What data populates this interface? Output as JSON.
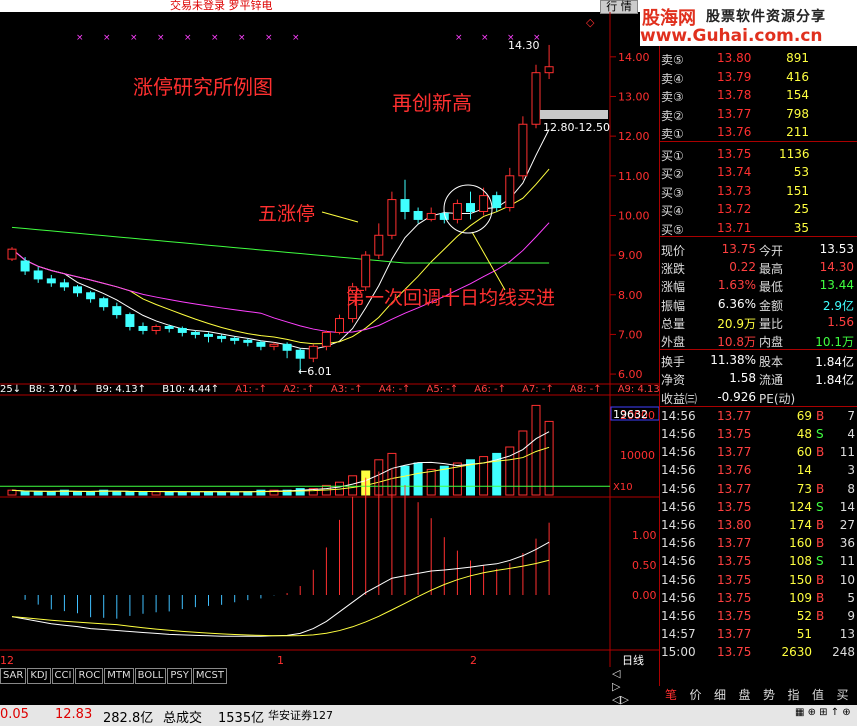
{
  "topbar": {
    "status": "交易未登录   罗平锌电",
    "button": "行 情"
  },
  "logo": {
    "brand": "股海网",
    "slogan": "股票软件资源分享",
    "url": "www.Guhai.com.cn"
  },
  "chart": {
    "annotation_title": "涨停研究所例图",
    "annotation_high": "再创新高",
    "annotation_limit": "五涨停",
    "annotation_pullback": "第一次回调十日均线买进",
    "high_label": "14.30",
    "low_label": "←6.01",
    "range_label": "12.80-12.50",
    "price_ticks": [
      "14.00",
      "13.00",
      "12.00",
      "11.00",
      "10.00",
      "9.00",
      "8.00",
      "7.00",
      "6.00"
    ],
    "ma_legend": [
      {
        "text": "25↓",
        "color": "#ffffff"
      },
      {
        "text": "B8: 3.70↓",
        "color": "#ffffff"
      },
      {
        "text": "B9: 4.13↑",
        "color": "#ffffff"
      },
      {
        "text": "B10: 4.44↑",
        "color": "#ffffff"
      },
      {
        "text": "A1: -↑",
        "color": "#ff4040"
      },
      {
        "text": "A2: -↑",
        "color": "#ff4040"
      },
      {
        "text": "A3: -↑",
        "color": "#ff4040"
      },
      {
        "text": "A4: -↑",
        "color": "#ff4040"
      },
      {
        "text": "A5: -↑",
        "color": "#ff4040"
      },
      {
        "text": "A6: -↑",
        "color": "#ff4040"
      },
      {
        "text": "A7: -↑",
        "color": "#ff4040"
      },
      {
        "text": "A8: -↑",
        "color": "#ff4040"
      },
      {
        "text": "A9: 4.13↑",
        "color": "#ff4040"
      },
      {
        "text": "A10: 4.44↑",
        "color": "#ff4040"
      }
    ],
    "vol_value": "19632",
    "vol_ticks": [
      "20000",
      "10000"
    ],
    "vol_unit": "X10",
    "macd_ticks": [
      "1.00",
      "0.50",
      "0.00"
    ],
    "date_labels": [
      "12",
      "1",
      "2"
    ],
    "period": "日线"
  },
  "indicator_tabs": [
    "SAR",
    "KDJ",
    "CCI",
    "ROC",
    "MTM",
    "BOLL",
    "PSY",
    "MCST"
  ],
  "order_book": {
    "sell": [
      {
        "label": "卖⑤",
        "price": "13.80",
        "vol": "891"
      },
      {
        "label": "卖④",
        "price": "13.79",
        "vol": "416"
      },
      {
        "label": "卖③",
        "price": "13.78",
        "vol": "154"
      },
      {
        "label": "卖②",
        "price": "13.77",
        "vol": "798"
      },
      {
        "label": "卖①",
        "price": "13.76",
        "vol": "211"
      }
    ],
    "buy": [
      {
        "label": "买①",
        "price": "13.75",
        "vol": "1136"
      },
      {
        "label": "买②",
        "price": "13.74",
        "vol": "53"
      },
      {
        "label": "买③",
        "price": "13.73",
        "vol": "151"
      },
      {
        "label": "买④",
        "price": "13.72",
        "vol": "25"
      },
      {
        "label": "买⑤",
        "price": "13.71",
        "vol": "35"
      }
    ]
  },
  "stats": [
    {
      "l1": "现价",
      "v1": "13.75",
      "c1": "#ff4040",
      "l2": "今开",
      "v2": "13.53",
      "c2": "#ffffff"
    },
    {
      "l1": "涨跌",
      "v1": "0.22",
      "c1": "#ff4040",
      "l2": "最高",
      "v2": "14.30",
      "c2": "#ff4040"
    },
    {
      "l1": "涨幅",
      "v1": "1.63%",
      "c1": "#ff4040",
      "l2": "最低",
      "v2": "13.44",
      "c2": "#40ff40"
    },
    {
      "l1": "振幅",
      "v1": "6.36%",
      "c1": "#ffffff",
      "l2": "金额",
      "v2": "2.9亿",
      "c2": "#40ffff"
    },
    {
      "l1": "总量",
      "v1": "20.9万",
      "c1": "#ffff40",
      "l2": "量比",
      "v2": "1.56",
      "c2": "#ff4040"
    },
    {
      "l1": "外盘",
      "v1": "10.8万",
      "c1": "#ff4040",
      "l2": "内盘",
      "v2": "10.1万",
      "c2": "#40ff40"
    },
    {
      "l1": "换手",
      "v1": "11.38%",
      "c1": "#ffffff",
      "l2": "股本",
      "v2": "1.84亿",
      "c2": "#ffffff"
    },
    {
      "l1": "净资",
      "v1": "1.58",
      "c1": "#ffffff",
      "l2": "流通",
      "v2": "1.84亿",
      "c2": "#ffffff"
    },
    {
      "l1": "收益㈢",
      "v1": "-0.926",
      "c1": "#ffffff",
      "l2": "PE(动)",
      "v2": "",
      "c2": "#ffffff"
    }
  ],
  "ticks": [
    {
      "t": "14:56",
      "p": "13.77",
      "pc": "#ff4040",
      "v": "69",
      "f": "B",
      "fc": "#ff4040",
      "n": "7"
    },
    {
      "t": "14:56",
      "p": "13.75",
      "pc": "#ff4040",
      "v": "48",
      "f": "S",
      "fc": "#40ff40",
      "n": "4"
    },
    {
      "t": "14:56",
      "p": "13.77",
      "pc": "#ff4040",
      "v": "60",
      "f": "B",
      "fc": "#ff4040",
      "n": "11"
    },
    {
      "t": "14:56",
      "p": "13.76",
      "pc": "#ff4040",
      "v": "14",
      "f": "",
      "fc": "#ffffff",
      "n": "3"
    },
    {
      "t": "14:56",
      "p": "13.77",
      "pc": "#ff4040",
      "v": "73",
      "f": "B",
      "fc": "#ff4040",
      "n": "8"
    },
    {
      "t": "14:56",
      "p": "13.75",
      "pc": "#ff4040",
      "v": "124",
      "f": "S",
      "fc": "#40ff40",
      "n": "14"
    },
    {
      "t": "14:56",
      "p": "13.80",
      "pc": "#ff4040",
      "v": "174",
      "f": "B",
      "fc": "#ff4040",
      "n": "27"
    },
    {
      "t": "14:56",
      "p": "13.77",
      "pc": "#ff4040",
      "v": "160",
      "f": "B",
      "fc": "#ff4040",
      "n": "36"
    },
    {
      "t": "14:56",
      "p": "13.75",
      "pc": "#ff4040",
      "v": "108",
      "f": "S",
      "fc": "#40ff40",
      "n": "11"
    },
    {
      "t": "14:56",
      "p": "13.75",
      "pc": "#ff4040",
      "v": "150",
      "f": "B",
      "fc": "#ff4040",
      "n": "10"
    },
    {
      "t": "14:56",
      "p": "13.75",
      "pc": "#ff4040",
      "v": "109",
      "f": "B",
      "fc": "#ff4040",
      "n": "5"
    },
    {
      "t": "14:56",
      "p": "13.75",
      "pc": "#ff4040",
      "v": "52",
      "f": "B",
      "fc": "#ff4040",
      "n": "9"
    },
    {
      "t": "14:57",
      "p": "13.77",
      "pc": "#ff4040",
      "v": "51",
      "f": "",
      "fc": "#ffffff",
      "n": "13"
    },
    {
      "t": "15:00",
      "p": "13.75",
      "pc": "#ff4040",
      "v": "2630",
      "f": "",
      "fc": "#ff40ff",
      "n": "248"
    }
  ],
  "quote_tabs": [
    "笔",
    "价",
    "细",
    "盘",
    "势",
    "指",
    "值",
    "买"
  ],
  "status_bar": {
    "v1": "0.05",
    "v2": "12.83",
    "v3": "282.8亿",
    "l4": "总成交",
    "v4": "1535亿",
    "broker": "华安证券127"
  },
  "chart_data": {
    "type": "candlestick",
    "price_range": [
      5.8,
      14.5
    ],
    "candles": [
      [
        8.9,
        9.15,
        8.85,
        9.2,
        "up"
      ],
      [
        8.85,
        8.6,
        8.5,
        8.95,
        "down"
      ],
      [
        8.6,
        8.4,
        8.3,
        8.7,
        "down"
      ],
      [
        8.4,
        8.3,
        8.2,
        8.5,
        "down"
      ],
      [
        8.3,
        8.2,
        8.1,
        8.4,
        "down"
      ],
      [
        8.2,
        8.05,
        7.95,
        8.25,
        "down"
      ],
      [
        8.05,
        7.9,
        7.8,
        8.1,
        "down"
      ],
      [
        7.9,
        7.7,
        7.6,
        7.95,
        "down"
      ],
      [
        7.7,
        7.5,
        7.4,
        7.8,
        "down"
      ],
      [
        7.5,
        7.2,
        7.1,
        7.55,
        "down"
      ],
      [
        7.2,
        7.1,
        7.0,
        7.3,
        "down"
      ],
      [
        7.1,
        7.2,
        7.0,
        7.25,
        "up"
      ],
      [
        7.2,
        7.15,
        7.05,
        7.25,
        "down"
      ],
      [
        7.15,
        7.05,
        6.95,
        7.2,
        "down"
      ],
      [
        7.05,
        7.0,
        6.9,
        7.1,
        "down"
      ],
      [
        7.0,
        6.95,
        6.8,
        7.05,
        "down"
      ],
      [
        6.95,
        6.9,
        6.8,
        7.0,
        "down"
      ],
      [
        6.9,
        6.85,
        6.75,
        6.95,
        "down"
      ],
      [
        6.85,
        6.8,
        6.7,
        6.9,
        "down"
      ],
      [
        6.8,
        6.7,
        6.6,
        6.85,
        "down"
      ],
      [
        6.7,
        6.75,
        6.6,
        6.8,
        "up"
      ],
      [
        6.75,
        6.6,
        6.4,
        6.8,
        "down"
      ],
      [
        6.6,
        6.4,
        6.01,
        6.65,
        "down"
      ],
      [
        6.4,
        6.7,
        6.3,
        6.75,
        "up"
      ],
      [
        6.7,
        7.05,
        6.6,
        7.1,
        "up"
      ],
      [
        7.05,
        7.4,
        7.0,
        7.5,
        "up"
      ],
      [
        7.4,
        8.2,
        7.3,
        8.3,
        "up"
      ],
      [
        8.2,
        9.0,
        8.1,
        9.1,
        "up"
      ],
      [
        9.0,
        9.5,
        8.9,
        9.8,
        "up"
      ],
      [
        9.5,
        10.4,
        9.4,
        10.6,
        "up"
      ],
      [
        10.4,
        10.1,
        9.9,
        10.9,
        "down"
      ],
      [
        10.1,
        9.9,
        9.8,
        10.2,
        "down"
      ],
      [
        9.9,
        10.05,
        9.85,
        10.2,
        "up"
      ],
      [
        10.05,
        9.9,
        9.8,
        10.1,
        "down"
      ],
      [
        9.9,
        10.3,
        9.8,
        10.4,
        "up"
      ],
      [
        10.3,
        10.1,
        9.9,
        10.6,
        "down"
      ],
      [
        10.1,
        10.5,
        10.0,
        10.7,
        "up"
      ],
      [
        10.5,
        10.2,
        10.1,
        10.6,
        "down"
      ],
      [
        10.2,
        11.0,
        10.1,
        11.2,
        "up"
      ],
      [
        11.0,
        12.3,
        10.9,
        12.5,
        "up"
      ],
      [
        12.3,
        13.6,
        12.2,
        13.8,
        "up"
      ],
      [
        13.6,
        13.75,
        13.44,
        14.3,
        "up"
      ]
    ],
    "volume": [
      3,
      2,
      2,
      2,
      3,
      2,
      2,
      3,
      2,
      2,
      2,
      2,
      2,
      2,
      2,
      2,
      2,
      2,
      2,
      3,
      3,
      3,
      4,
      4,
      6,
      8,
      12,
      15,
      22,
      26,
      18,
      20,
      16,
      18,
      20,
      22,
      24,
      26,
      30,
      40,
      56,
      46
    ],
    "macd_dif": [
      -0.45,
      -0.5,
      -0.55,
      -0.6,
      -0.63,
      -0.66,
      -0.7,
      -0.72,
      -0.74,
      -0.76,
      -0.78,
      -0.8,
      -0.82,
      -0.83,
      -0.84,
      -0.85,
      -0.86,
      -0.86,
      -0.86,
      -0.86,
      -0.85,
      -0.84,
      -0.8,
      -0.7,
      -0.55,
      -0.35,
      -0.15,
      0.05,
      0.2,
      0.35,
      0.4,
      0.45,
      0.5,
      0.52,
      0.55,
      0.58,
      0.62,
      0.65,
      0.72,
      0.82,
      0.95,
      1.1
    ]
  }
}
